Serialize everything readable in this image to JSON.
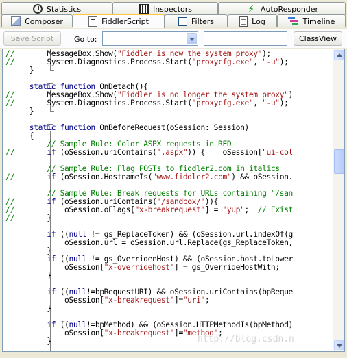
{
  "tabs_row1": [
    {
      "label": "Statistics",
      "icon": "stopwatch-icon"
    },
    {
      "label": "Inspectors",
      "icon": "inspectors-icon"
    },
    {
      "label": "AutoResponder",
      "icon": "lightning-icon"
    }
  ],
  "tabs_row2": [
    {
      "label": "Composer",
      "icon": "pencil-icon"
    },
    {
      "label": "FiddlerScript",
      "icon": "script-icon",
      "active": true
    },
    {
      "label": "Filters",
      "icon": "checkbox-icon"
    },
    {
      "label": "Log",
      "icon": "log-icon"
    },
    {
      "label": "Timeline",
      "icon": "timeline-icon"
    }
  ],
  "toolbar": {
    "save_label": "Save Script",
    "goto_label": "Go to:",
    "goto_value": "",
    "search_value": "",
    "classview_label": "ClassView"
  },
  "colors": {
    "keyword": "#00008b",
    "comment": "#008000",
    "string": "#a31515",
    "active_tab_accent": "#ffc73c"
  },
  "code_lines": [
    {
      "gutter": "//",
      "segs": [
        [
          "pl",
          "      MessageBox.Show("
        ],
        [
          "str",
          "\"Fiddler is now the system proxy\""
        ],
        [
          "pl",
          ");"
        ]
      ]
    },
    {
      "gutter": "//",
      "segs": [
        [
          "pl",
          "      System.Diagnostics.Process.Start("
        ],
        [
          "str",
          "\"proxycfg.exe\""
        ],
        [
          "pl",
          ", "
        ],
        [
          "str",
          "\"-u\""
        ],
        [
          "pl",
          ");"
        ]
      ]
    },
    {
      "gutter": "",
      "segs": [
        [
          "pl",
          "  }"
        ]
      ]
    },
    {
      "gutter": "",
      "segs": [
        [
          "pl",
          ""
        ]
      ]
    },
    {
      "gutter": "",
      "segs": [
        [
          "kw",
          "  static function"
        ],
        [
          "pl",
          " OnDetach(){"
        ]
      ]
    },
    {
      "gutter": "//",
      "segs": [
        [
          "pl",
          "      MessageBox.Show("
        ],
        [
          "str",
          "\"Fiddler is no longer the system proxy\""
        ],
        [
          "pl",
          ")"
        ]
      ]
    },
    {
      "gutter": "//",
      "segs": [
        [
          "pl",
          "      System.Diagnostics.Process.Start("
        ],
        [
          "str",
          "\"proxycfg.exe\""
        ],
        [
          "pl",
          ", "
        ],
        [
          "str",
          "\"-u\""
        ],
        [
          "pl",
          ");"
        ]
      ]
    },
    {
      "gutter": "",
      "segs": [
        [
          "pl",
          "  }"
        ]
      ]
    },
    {
      "gutter": "",
      "segs": [
        [
          "pl",
          ""
        ]
      ]
    },
    {
      "gutter": "",
      "segs": [
        [
          "kw",
          "  static function"
        ],
        [
          "pl",
          " OnBeforeRequest(oSession: Session)"
        ]
      ]
    },
    {
      "gutter": "",
      "segs": [
        [
          "pl",
          "  {"
        ]
      ]
    },
    {
      "gutter": "",
      "segs": [
        [
          "cm",
          "      // Sample Rule: Color ASPX requests in RED"
        ]
      ]
    },
    {
      "gutter": "//",
      "segs": [
        [
          "kw",
          "      if"
        ],
        [
          "pl",
          " (oSession.uriContains("
        ],
        [
          "str",
          "\".aspx\""
        ],
        [
          "pl",
          ")) {    oSession["
        ],
        [
          "str",
          "\"ui-col"
        ]
      ]
    },
    {
      "gutter": "",
      "segs": [
        [
          "pl",
          ""
        ]
      ]
    },
    {
      "gutter": "",
      "segs": [
        [
          "cm",
          "      // Sample Rule: Flag POSTs to fiddler2.com in italics"
        ]
      ]
    },
    {
      "gutter": "//",
      "segs": [
        [
          "kw",
          "      if"
        ],
        [
          "pl",
          " (oSession.HostnameIs("
        ],
        [
          "str",
          "\"www.fiddler2.com\""
        ],
        [
          "pl",
          ") && oSession."
        ]
      ]
    },
    {
      "gutter": "",
      "segs": [
        [
          "pl",
          ""
        ]
      ]
    },
    {
      "gutter": "",
      "segs": [
        [
          "cm",
          "      // Sample Rule: Break requests for URLs containing \"/san"
        ]
      ]
    },
    {
      "gutter": "//",
      "segs": [
        [
          "kw",
          "      if"
        ],
        [
          "pl",
          " (oSession.uriContains("
        ],
        [
          "str",
          "\"/sandbox/\""
        ],
        [
          "pl",
          ")){"
        ]
      ]
    },
    {
      "gutter": "//",
      "segs": [
        [
          "pl",
          "          oSession.oFlags["
        ],
        [
          "str",
          "\"x-breakrequest\""
        ],
        [
          "pl",
          "] = "
        ],
        [
          "str",
          "\"yup\""
        ],
        [
          "pl",
          ";  "
        ],
        [
          "cm",
          "// Exist"
        ]
      ]
    },
    {
      "gutter": "//",
      "segs": [
        [
          "pl",
          "      }"
        ]
      ]
    },
    {
      "gutter": "",
      "segs": [
        [
          "pl",
          ""
        ]
      ]
    },
    {
      "gutter": "",
      "segs": [
        [
          "kw",
          "      if"
        ],
        [
          "pl",
          " (("
        ],
        [
          "kw",
          "null"
        ],
        [
          "pl",
          " != gs_ReplaceToken) && (oSession.url.indexOf(g"
        ]
      ]
    },
    {
      "gutter": "",
      "segs": [
        [
          "pl",
          "          oSession.url = oSession.url.Replace(gs_ReplaceToken,"
        ]
      ]
    },
    {
      "gutter": "",
      "segs": [
        [
          "pl",
          "      }"
        ]
      ]
    },
    {
      "gutter": "",
      "segs": [
        [
          "kw",
          "      if"
        ],
        [
          "pl",
          " (("
        ],
        [
          "kw",
          "null"
        ],
        [
          "pl",
          " != gs_OverridenHost) && (oSession.host.toLower"
        ]
      ]
    },
    {
      "gutter": "",
      "segs": [
        [
          "pl",
          "          oSession["
        ],
        [
          "str",
          "\"x-overridehost\""
        ],
        [
          "pl",
          "] = gs_OverrideHostWith;"
        ]
      ]
    },
    {
      "gutter": "",
      "segs": [
        [
          "pl",
          "      }"
        ]
      ]
    },
    {
      "gutter": "",
      "segs": [
        [
          "pl",
          ""
        ]
      ]
    },
    {
      "gutter": "",
      "segs": [
        [
          "kw",
          "      if"
        ],
        [
          "pl",
          " (("
        ],
        [
          "kw",
          "null"
        ],
        [
          "pl",
          "!=bpRequestURI) && oSession.uriContains(bpReque"
        ]
      ]
    },
    {
      "gutter": "",
      "segs": [
        [
          "pl",
          "          oSession["
        ],
        [
          "str",
          "\"x-breakrequest\""
        ],
        [
          "pl",
          "]="
        ],
        [
          "str",
          "\"uri\""
        ],
        [
          "pl",
          ";"
        ]
      ]
    },
    {
      "gutter": "",
      "segs": [
        [
          "pl",
          "      }"
        ]
      ]
    },
    {
      "gutter": "",
      "segs": [
        [
          "pl",
          ""
        ]
      ]
    },
    {
      "gutter": "",
      "segs": [
        [
          "kw",
          "      if"
        ],
        [
          "pl",
          " (("
        ],
        [
          "kw",
          "null"
        ],
        [
          "pl",
          "!=bpMethod) && (oSession.HTTPMethodIs(bpMethod)"
        ]
      ]
    },
    {
      "gutter": "",
      "segs": [
        [
          "pl",
          "          oSession["
        ],
        [
          "str",
          "\"x-breakrequest\""
        ],
        [
          "pl",
          "]="
        ],
        [
          "str",
          "\"method\""
        ],
        [
          "pl",
          ";"
        ]
      ]
    },
    {
      "gutter": "",
      "segs": [
        [
          "pl",
          "      }"
        ]
      ]
    }
  ],
  "watermark": "http://blog.csdn.n"
}
